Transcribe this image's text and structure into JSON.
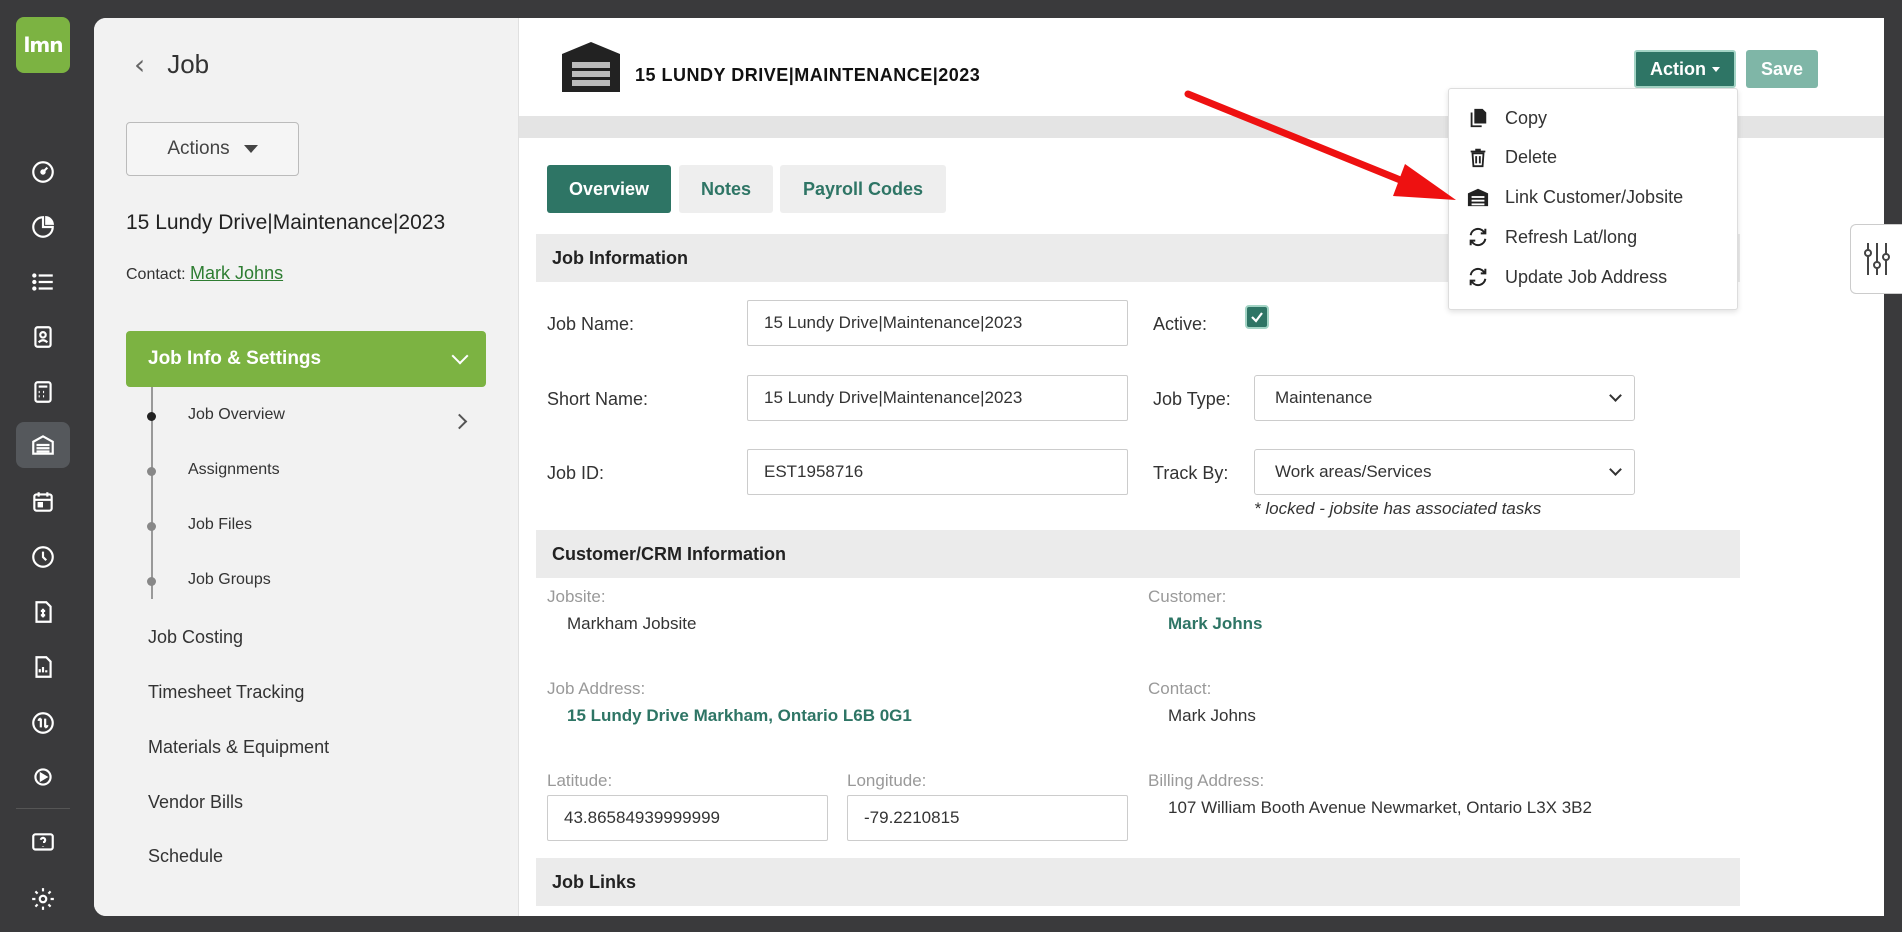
{
  "rail": {
    "logo_text": "lmn",
    "icons": [
      "dashboard-icon",
      "pie-chart-icon",
      "list-icon",
      "contacts-icon",
      "calculator-icon",
      "jobs-icon",
      "calendar-icon",
      "clock-icon",
      "invoice-icon",
      "report-icon",
      "quickbooks-icon",
      "video-icon",
      "help-icon",
      "settings-icon"
    ]
  },
  "sidebar": {
    "title": "Job",
    "actions_label": "Actions",
    "job_name": "15 Lundy Drive|Maintenance|2023",
    "contact_label": "Contact:",
    "contact_name": "Mark Johns",
    "section_label": "Job Info & Settings",
    "sub_items": [
      "Job Overview",
      "Assignments",
      "Job Files",
      "Job Groups"
    ],
    "links": [
      "Job Costing",
      "Timesheet Tracking",
      "Materials & Equipment",
      "Vendor Bills",
      "Schedule"
    ]
  },
  "header": {
    "title": "15 LUNDY DRIVE|MAINTENANCE|2023",
    "action_label": "Action",
    "save_label": "Save"
  },
  "action_menu": {
    "items": [
      {
        "label": "Copy",
        "icon": "copy-icon"
      },
      {
        "label": "Delete",
        "icon": "trash-icon"
      },
      {
        "label": "Link Customer/Jobsite",
        "icon": "jobsite-icon"
      },
      {
        "label": "Refresh Lat/long",
        "icon": "refresh-icon"
      },
      {
        "label": "Update Job Address",
        "icon": "refresh-icon"
      }
    ]
  },
  "tabs": [
    "Overview",
    "Notes",
    "Payroll Codes"
  ],
  "job_info": {
    "heading": "Job Information",
    "job_name_label": "Job Name:",
    "job_name_value": "15 Lundy Drive|Maintenance|2023",
    "short_name_label": "Short Name:",
    "short_name_value": "15 Lundy Drive|Maintenance|2023",
    "job_id_label": "Job ID:",
    "job_id_value": "EST1958716",
    "active_label": "Active:",
    "active": true,
    "job_type_label": "Job Type:",
    "job_type_value": "Maintenance",
    "track_by_label": "Track By:",
    "track_by_value": "Work areas/Services",
    "track_note": "* locked - jobsite has associated tasks"
  },
  "crm": {
    "heading": "Customer/CRM Information",
    "jobsite_label": "Jobsite:",
    "jobsite_value": "Markham Jobsite",
    "customer_label": "Customer:",
    "customer_value": "Mark Johns",
    "address_label": "Job Address:",
    "address_value": "15 Lundy Drive Markham, Ontario L6B 0G1",
    "contact_label": "Contact:",
    "contact_value": "Mark Johns",
    "latitude_label": "Latitude:",
    "latitude_value": "43.86584939999999",
    "longitude_label": "Longitude:",
    "longitude_value": "-79.2210815",
    "billing_label": "Billing Address:",
    "billing_value": "107 William Booth Avenue Newmarket, Ontario L3X 3B2"
  },
  "links_heading": "Job Links",
  "colors": {
    "brand_green": "#7cb342",
    "primary_teal": "#2e7565",
    "annotation_arrow": "#ee1111"
  }
}
